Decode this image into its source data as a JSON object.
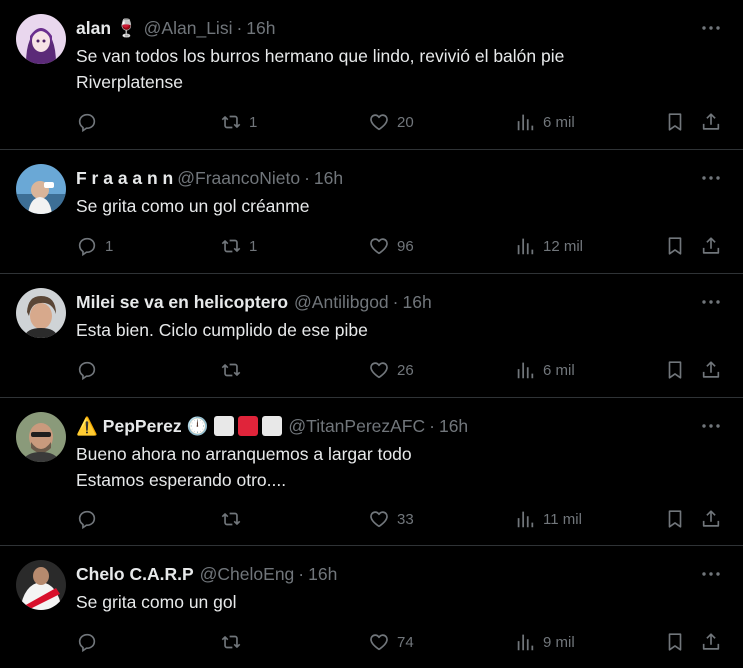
{
  "tweets": [
    {
      "name": "alan 🍷",
      "handle": "@Alan_Lisi",
      "dot": "·",
      "time": "16h",
      "lines": [
        "Se van todos los burros hermano que lindo, revivió el balón pie",
        "Riverplatense"
      ],
      "replies": "",
      "retweets": "1",
      "likes": "20",
      "views": "6 mil"
    },
    {
      "name": "F r a a a n n",
      "handle": "@FraancoNieto",
      "dot": "·",
      "time": "16h",
      "lines": [
        "Se grita como un gol créanme"
      ],
      "replies": "1",
      "retweets": "1",
      "likes": "96",
      "views": "12 mil"
    },
    {
      "name": "Milei se va en helicoptero",
      "handle": "@Antilibgod",
      "dot": "·",
      "time": "16h",
      "lines": [
        "Esta bien. Ciclo cumplido de ese pibe"
      ],
      "replies": "",
      "retweets": "",
      "likes": "26",
      "views": "6 mil"
    },
    {
      "name_prefix": "⚠️",
      "name": "PepPerez",
      "name_suffix": "🕛",
      "handle": "@TitanPerezAFC",
      "dot": "·",
      "time": "16h",
      "lines": [
        "Bueno ahora no arranquemos a largar todo",
        "Estamos esperando otro...."
      ],
      "replies": "",
      "retweets": "",
      "likes": "33",
      "views": "11 mil"
    },
    {
      "name": "Chelo C.A.R.P",
      "handle": "@CheloEng",
      "dot": "·",
      "time": "16h",
      "lines": [
        "Se grita como un gol"
      ],
      "replies": "",
      "retweets": "",
      "likes": "74",
      "views": "9 mil"
    }
  ],
  "colors": {
    "background": "#000000",
    "text": "#e7e9ea",
    "muted": "#71767b",
    "divider": "#2f3336",
    "flag_red": "#e0243a",
    "flag_white": "#e8e8e8"
  },
  "icons": {
    "reply": "reply-icon",
    "retweet": "retweet-icon",
    "like": "heart-icon",
    "views": "views-icon",
    "bookmark": "bookmark-icon",
    "share": "share-icon",
    "more": "more-icon"
  }
}
